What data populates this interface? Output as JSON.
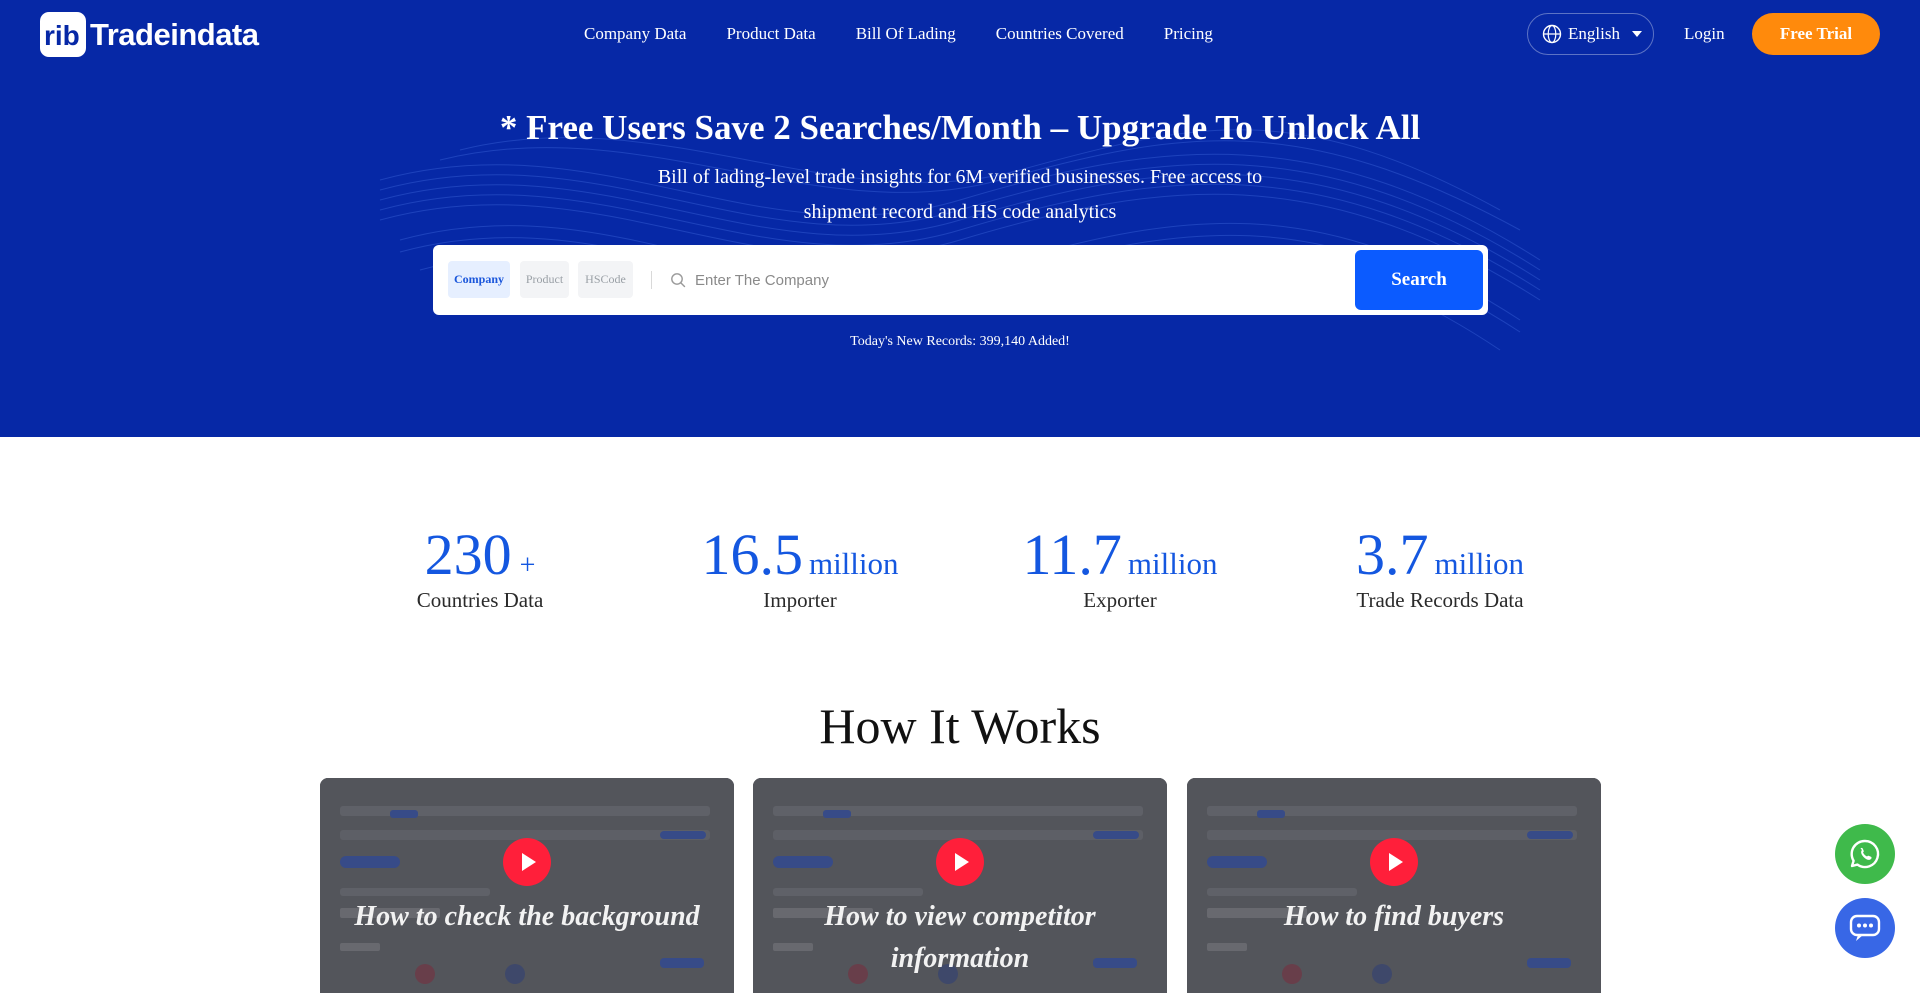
{
  "brand": {
    "name": "Tradeindata"
  },
  "nav": {
    "links": [
      "Company Data",
      "Product Data",
      "Bill Of Lading",
      "Countries Covered",
      "Pricing"
    ],
    "language": "English",
    "login": "Login",
    "free_trial": "Free Trial"
  },
  "hero": {
    "title": "* Free Users Save 2 Searches/Month – Upgrade To Unlock All",
    "subtitle": "Bill of lading-level trade insights for 6M verified businesses. Free access to shipment record and HS code analytics",
    "search": {
      "tabs": [
        "Company",
        "Product",
        "HSCode"
      ],
      "active_tab": "Company",
      "placeholder": "Enter The Company",
      "value": "",
      "button": "Search"
    },
    "records_note": "Today's New Records: 399,140 Added!"
  },
  "stats": [
    {
      "number": "230",
      "suffix": "+",
      "label": "Countries Data"
    },
    {
      "number": "16.5",
      "suffix": "million",
      "label": "Importer"
    },
    {
      "number": "11.7",
      "suffix": "million",
      "label": "Exporter"
    },
    {
      "number": "3.7",
      "suffix": "million",
      "label": "Trade Records Data"
    }
  ],
  "how_it_works": {
    "title": "How It Works",
    "cards": [
      {
        "title": "How to check the background"
      },
      {
        "title": "How to view competitor information"
      },
      {
        "title": "How to find buyers"
      }
    ]
  },
  "floating": {
    "whatsapp_icon": "whatsapp-icon",
    "chat_icon": "chat-bot-icon"
  },
  "colors": {
    "hero_bg": "#0628a6",
    "accent_blue": "#0b5bff",
    "stat_blue": "#1457e0",
    "trial_orange": "#ff8a0c",
    "play_red": "#ff1f3a",
    "whatsapp_green": "#3fba4b"
  }
}
